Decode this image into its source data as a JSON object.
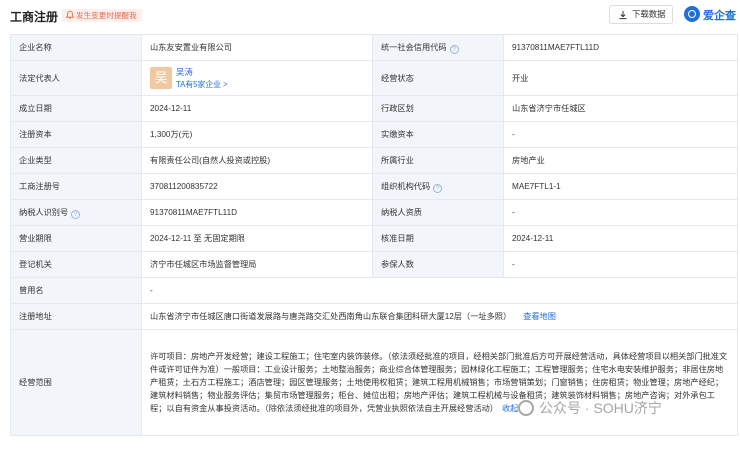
{
  "header": {
    "title": "工商注册",
    "reminder": "发生变更时提醒我",
    "download_label": "下载数据",
    "logo_text": "爱企查"
  },
  "rows": [
    {
      "l1": "企业名称",
      "v1": "山东友安置业有限公司",
      "l2": "统一社会信用代码",
      "v2": "91370811MAE7FTL11D"
    },
    {
      "l1": "法定代表人",
      "l2": "经营状态",
      "v2": "开业"
    },
    {
      "l1": "成立日期",
      "v1": "2024-12-11",
      "l2": "行政区划",
      "v2": "山东省济宁市任城区"
    },
    {
      "l1": "注册资本",
      "v1": "1,300万(元)",
      "l2": "实缴资本",
      "v2": "-"
    },
    {
      "l1": "企业类型",
      "v1": "有限责任公司(自然人投资或控股)",
      "l2": "所属行业",
      "v2": "房地产业"
    },
    {
      "l1": "工商注册号",
      "v1": "370811200835722",
      "l2": "组织机构代码",
      "v2": "MAE7FTL1-1"
    },
    {
      "l1": "纳税人识别号",
      "v1": "91370811MAE7FTL11D",
      "l2": "纳税人资质",
      "v2": "-"
    },
    {
      "l1": "营业期限",
      "v1": "2024-12-11 至 无固定期限",
      "l2": "核准日期",
      "v2": "2024-12-11"
    },
    {
      "l1": "登记机关",
      "v1": "济宁市任城区市场监督管理局",
      "l2": "参保人数",
      "v2": "-"
    }
  ],
  "legal_rep": {
    "avatar_char": "吴",
    "name": "吴涛",
    "sub": "TA有5家企业 >"
  },
  "former_name": {
    "label": "曾用名",
    "value": "-"
  },
  "address": {
    "label": "注册地址",
    "value": "山东省济宁市任城区唐口街道发展路与唐尧路交汇处西南角山东联合集团科研大厦12层（一址多照）",
    "map_link": "查看地图"
  },
  "scope": {
    "label": "经营范围",
    "value": "许可项目：房地产开发经营；建设工程施工；住宅室内装饰装修。（依法须经批准的项目，经相关部门批准后方可开展经营活动，具体经营项目以相关部门批准文件或许可证件为准）一般项目：工业设计服务；土地整治服务；商业综合体管理服务；园林绿化工程施工；工程管理服务；住宅水电安装维护服务；非居住房地产租赁；土石方工程施工；酒店管理；园区管理服务；土地使用权租赁；建筑工程用机械销售；市场营销策划；门窗销售；住房租赁；物业管理；房地产经纪；建筑材料销售；物业服务评估；集贸市场管理服务；柜台、摊位出租；房地产评估；建筑工程机械与设备租赁；建筑装饰材料销售；房地产咨询；对外承包工程；以自有资金从事投资活动。（除依法须经批准的项目外，凭营业执照依法自主开展经营活动）",
    "collapse": "收起"
  },
  "watermark": "公众号 · SOHU济宁"
}
